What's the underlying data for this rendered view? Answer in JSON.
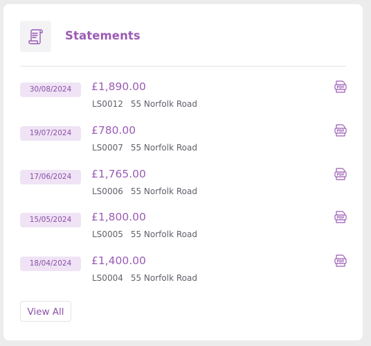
{
  "header": {
    "title": "Statements",
    "icon": "document-scroll-icon"
  },
  "statements": [
    {
      "date": "30/08/2024",
      "amount": "£1,890.00",
      "ref": "LS0012",
      "address": "55 Norfolk Road"
    },
    {
      "date": "19/07/2024",
      "amount": "£780.00",
      "ref": "LS0007",
      "address": "55 Norfolk Road"
    },
    {
      "date": "17/06/2024",
      "amount": "£1,765.00",
      "ref": "LS0006",
      "address": "55 Norfolk Road"
    },
    {
      "date": "15/05/2024",
      "amount": "£1,800.00",
      "ref": "LS0005",
      "address": "55 Norfolk Road"
    },
    {
      "date": "18/04/2024",
      "amount": "£1,400.00",
      "ref": "LS0004",
      "address": "55 Norfolk Road"
    }
  ],
  "actions": {
    "view_all": "View All"
  },
  "colors": {
    "accent": "#9a5bb5",
    "badge_bg": "#efe3f5",
    "text_muted": "#60606a"
  }
}
